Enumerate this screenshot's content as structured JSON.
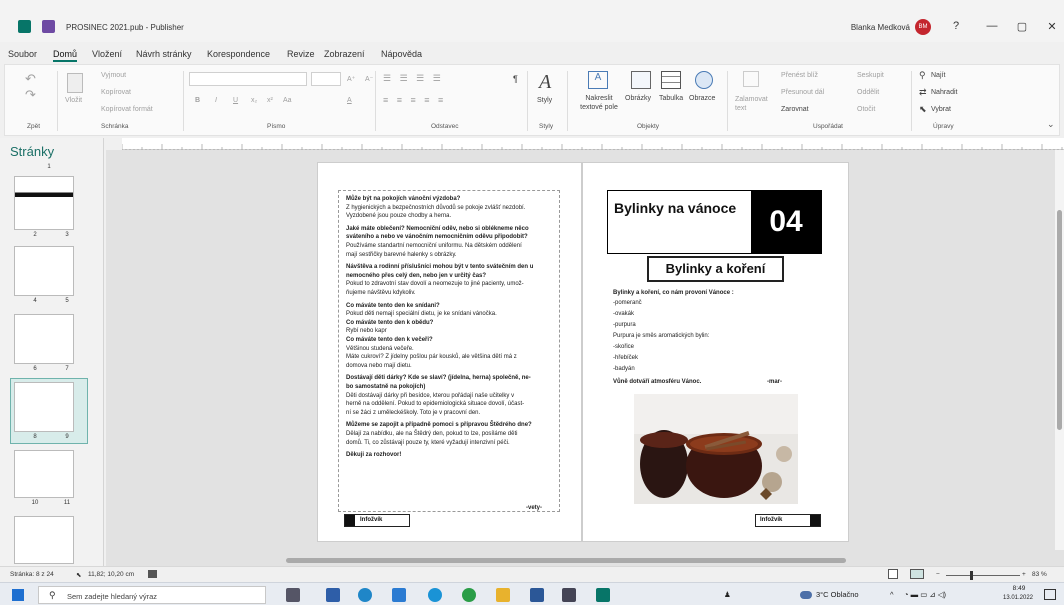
{
  "window": {
    "title": "PROSINEC 2021.pub - Publisher",
    "user_name": "Blanka Medková",
    "user_initials": "BM",
    "help": "?",
    "minimize": "—",
    "restore": "▢",
    "close": "✕"
  },
  "menu": {
    "items": [
      "Soubor",
      "Domů",
      "Vložení",
      "Návrh stránky",
      "Korespondence",
      "Revize",
      "Zobrazení",
      "Nápověda"
    ],
    "active": "Domů"
  },
  "ribbon": {
    "clipboard": {
      "paste": "Vložit",
      "cut": "Vyjmout",
      "copy": "Kopírovat",
      "format_painter": "Kopírovat formát",
      "group": "Schránka"
    },
    "undo_group": "Zpět",
    "font": {
      "bold": "B",
      "italic": "I",
      "underline": "U",
      "sub": "x₂",
      "sup": "x²",
      "case": "Aa",
      "grow": "A⁺",
      "shrink": "A⁻",
      "clear": "A",
      "group": "Písmo"
    },
    "paragraph": {
      "group": "Odstavec",
      "pilcrow": "¶"
    },
    "styles": {
      "label": "Styly",
      "group": "Styly"
    },
    "objects": {
      "textbox": "Nakreslit textové pole",
      "pictures": "Obrázky",
      "table": "Tabulka",
      "shapes": "Obrazce",
      "group": "Objekty"
    },
    "wrap": {
      "label": "Zalamovat text"
    },
    "arrange": {
      "bring_forward": "Přenést blíž",
      "send_backward": "Přesunout dál",
      "align": "Zarovnat",
      "group_btn": "Seskupit",
      "ungroup": "Oddělit",
      "rotate": "Otočit",
      "group": "Uspořádat"
    },
    "editing": {
      "find": "Najít",
      "replace": "Nahradit",
      "select": "Vybrat",
      "group": "Úpravy"
    }
  },
  "pages_pane": {
    "title": "Stránky",
    "numbers": [
      "1",
      "2",
      "3",
      "4",
      "5",
      "6",
      "7",
      "8",
      "9",
      "10",
      "11"
    ]
  },
  "left_page": {
    "lines": [
      {
        "t": "Může být na pokojích vánoční výzdoba?",
        "b": true
      },
      {
        "t": "Z hygienických a bezpečnostních důvodů se pokoje zvlášť nezdobí.",
        "b": false
      },
      {
        "t": "Vyzdobené jsou pouze chodby a herna.",
        "b": false
      },
      {
        "t": "",
        "b": false
      },
      {
        "t": "Jaké máte oblečení? Nemocniční oděv, nebo si oblékneme něco",
        "b": true
      },
      {
        "t": "sváteního a nebo ve vánočním nemocničním oděvu připodobit?",
        "b": true
      },
      {
        "t": "Používáme standartní nemocniční uniformu. Na dětském oddělení",
        "b": false
      },
      {
        "t": "mají sestřičky barevné halenky s obrázky.",
        "b": false
      },
      {
        "t": "",
        "b": false
      },
      {
        "t": "Návštěva a rodinní příslušníci mohou být v tento svátečním den u",
        "b": true
      },
      {
        "t": "nemocného přes celý den, nebo jen v určitý čas?",
        "b": true
      },
      {
        "t": "Pokud to zdravotní stav dovolí a neomezuje to jiné pacienty, umož-",
        "b": false
      },
      {
        "t": "ňujeme návštěvu kdykoliv.",
        "b": false
      },
      {
        "t": "",
        "b": false
      },
      {
        "t": "Co máváte tento den ke snídani?",
        "b": true
      },
      {
        "t": "Pokud děti nemají speciální dietu, je ke snídani vánočka.",
        "b": false
      },
      {
        "t": "Co máváte tento den k obědu?",
        "b": true
      },
      {
        "t": "Rybí nebo kapr",
        "b": false
      },
      {
        "t": "Co máváte tento den k večeři?",
        "b": true
      },
      {
        "t": "Většinou studená večeře.",
        "b": false
      },
      {
        "t": "Máte cukroví? Z jídelny pošlou pár kousků, ale většina dětí má z",
        "b": false
      },
      {
        "t": "domova nebo mají dietu.",
        "b": false
      },
      {
        "t": "",
        "b": false
      },
      {
        "t": "Dostávají děti dárky? Kde se slaví? (jídelna, herna) společně, ne-",
        "b": true
      },
      {
        "t": "bo samostatně na pokojích)",
        "b": true
      },
      {
        "t": "Děti dostávají dárky při besídce, kterou pořádají naše učitelky v",
        "b": false
      },
      {
        "t": "herně na oddělení. Pokud to epidemiologická situace dovolí, účast-",
        "b": false
      },
      {
        "t": "ní se žáci z uměleckéškoly. Toto je v pracovní den.",
        "b": false
      },
      {
        "t": "",
        "b": false
      },
      {
        "t": "Můžeme se zapojit a případně pomoci s přípravou Štědrého dne?",
        "b": true
      },
      {
        "t": "Dělají za nabídku, ale na Štědrý den, pokud to lze, posíláme děti",
        "b": false
      },
      {
        "t": "domů. Ti, co zůstávají pouze ty, které vyžadují intenzivní péči.",
        "b": false
      },
      {
        "t": "",
        "b": false
      },
      {
        "t": "Děkuji za rozhovor!",
        "b": true
      }
    ],
    "signature": "-vety-",
    "footer_label": "Infožvík"
  },
  "right_page": {
    "header_title": "Bylinky na vánoce",
    "header_number": "04",
    "subtitle": "Bylinky a koření",
    "intro": "Bylinky a koření, co nám provoní Vánoce :",
    "items": [
      "-pomeranč",
      "-ovakák",
      "-purpura",
      "Purpura je směs aromatických bylin:",
      "-skořice",
      "-hřebíček",
      "-badyán"
    ],
    "closing": "Vůně dotváří atmosféru Vánoc.",
    "signature": "-mar-",
    "footer_label": "Infožvík"
  },
  "status": {
    "page": "Stránka: 8 z 24",
    "position": "11,82; 10,20 cm",
    "zoom": "83 %"
  },
  "taskbar": {
    "search_placeholder": "Sem zadejte hledaný výraz",
    "weather": "3°C Oblačno",
    "time": "8:49",
    "date": "13.01.2022"
  }
}
